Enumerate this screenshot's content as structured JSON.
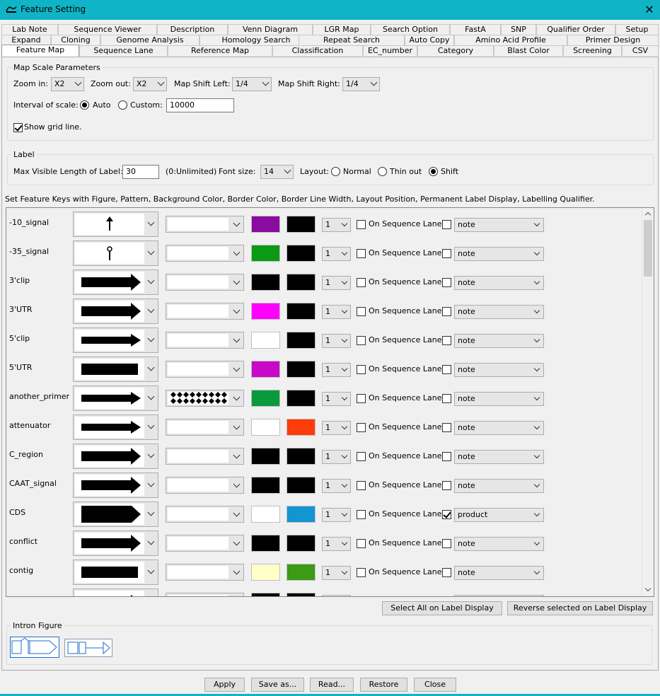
{
  "window": {
    "title": "Feature Setting",
    "close_glyph": "✕",
    "accent": "#0fb4c6"
  },
  "tabs": {
    "row1": [
      "Lab Note",
      "Sequence Viewer",
      "Description",
      "Venn Diagram",
      "LGR Map",
      "Search Option",
      "FastA",
      "SNP",
      "Qualifier Order",
      "Setup"
    ],
    "row2": [
      "Expand",
      "Cloning",
      "Genome Analysis",
      "Homology Search",
      "Repeat Search",
      "Auto Copy",
      "Amino Acid Profile",
      "Primer Design"
    ],
    "row3": [
      "Feature Map",
      "Sequence Lane",
      "Reference Map",
      "Classification",
      "EC_number",
      "Category",
      "Blast Color",
      "Screening",
      "CSV"
    ],
    "active": "Feature Map"
  },
  "map_scale": {
    "legend": "Map Scale Parameters",
    "zoom_in_label": "Zoom in:",
    "zoom_in_value": "X2",
    "zoom_out_label": "Zoom out:",
    "zoom_out_value": "X2",
    "shift_left_label": "Map Shift Left:",
    "shift_left_value": "1/4",
    "shift_right_label": "Map Shift Right:",
    "shift_right_value": "1/4",
    "interval_label": "Interval of scale:",
    "auto_label": "Auto",
    "custom_label": "Custom:",
    "custom_value": "10000",
    "interval_selected": "Auto",
    "grid_label": "Show grid line.",
    "grid_checked": true
  },
  "label_group": {
    "legend": "Label",
    "max_len_label": "Max Visible Length of Label:",
    "max_len_value": "30",
    "unlimited_note": "(0:Unlimited)",
    "font_size_label": "Font size:",
    "font_size_value": "14",
    "layout_label": "Layout:",
    "layout_options": [
      "Normal",
      "Thin out",
      "Shift"
    ],
    "layout_selected": "Shift"
  },
  "instructions": "Set Feature Keys with Figure, Pattern, Background Color, Border Color, Border Line Width, Layout Position, Permanent Label Display, Labelling Qualifier.",
  "seq_lane_label": "On Sequence Lane",
  "features": [
    {
      "name": "-10_signal",
      "figure": "up-arrow-icon",
      "pattern": "none",
      "bg": "#8b0a9f",
      "border": "#000000",
      "width": "1",
      "on_lane": false,
      "label_display": false,
      "qualifier": "note"
    },
    {
      "name": "-35_signal",
      "figure": "pin-icon",
      "pattern": "none",
      "bg": "#0a9a14",
      "border": "#000000",
      "width": "1",
      "on_lane": false,
      "label_display": false,
      "qualifier": "note"
    },
    {
      "name": "3'clip",
      "figure": "large-arrow",
      "pattern": "none",
      "bg": "#000000",
      "border": "#000000",
      "width": "1",
      "on_lane": false,
      "label_display": false,
      "qualifier": "note"
    },
    {
      "name": "3'UTR",
      "figure": "large-arrow",
      "pattern": "none",
      "bg": "#ff00ff",
      "border": "#000000",
      "width": "1",
      "on_lane": false,
      "label_display": false,
      "qualifier": "note"
    },
    {
      "name": "5'clip",
      "figure": "medium-arrow",
      "pattern": "none",
      "bg": "#ffffff",
      "border": "#000000",
      "width": "1",
      "on_lane": false,
      "label_display": false,
      "qualifier": "note"
    },
    {
      "name": "5'UTR",
      "figure": "bar",
      "pattern": "none",
      "bg": "#c80ac8",
      "border": "#000000",
      "width": "1",
      "on_lane": false,
      "label_display": false,
      "qualifier": "note"
    },
    {
      "name": "another_primer",
      "figure": "medium-arrow",
      "pattern": "diamonds",
      "bg": "#0a9a3c",
      "border": "#000000",
      "width": "1",
      "on_lane": false,
      "label_display": false,
      "qualifier": "note"
    },
    {
      "name": "attenuator",
      "figure": "medium-arrow",
      "pattern": "none",
      "bg": "#ffffff",
      "border": "#ff3c0a",
      "width": "1",
      "on_lane": false,
      "label_display": false,
      "qualifier": "note"
    },
    {
      "name": "C_region",
      "figure": "large-arrow",
      "pattern": "none",
      "bg": "#000000",
      "border": "#000000",
      "width": "1",
      "on_lane": false,
      "label_display": false,
      "qualifier": "note"
    },
    {
      "name": "CAAT_signal",
      "figure": "large-arrow",
      "pattern": "none",
      "bg": "#000000",
      "border": "#000000",
      "width": "1",
      "on_lane": false,
      "label_display": false,
      "qualifier": "note"
    },
    {
      "name": "CDS",
      "figure": "large-block-arrow",
      "pattern": "none",
      "bg": "#ffffff",
      "border": "#1296d2",
      "width": "1",
      "on_lane": false,
      "label_display": true,
      "qualifier": "product"
    },
    {
      "name": "conflict",
      "figure": "large-arrow",
      "pattern": "none",
      "bg": "#000000",
      "border": "#000000",
      "width": "1",
      "on_lane": false,
      "label_display": false,
      "qualifier": "note"
    },
    {
      "name": "contig",
      "figure": "bar",
      "pattern": "none",
      "bg": "#ffffc8",
      "border": "#3c9a14",
      "width": "1",
      "on_lane": false,
      "label_display": false,
      "qualifier": "note"
    }
  ],
  "buttons": {
    "select_all": "Select All on Label Display",
    "reverse": "Reverse selected on Label Display",
    "apply": "Apply",
    "save_as": "Save as...",
    "read": "Read...",
    "restore": "Restore",
    "close": "Close"
  },
  "intron": {
    "legend": "Intron Figure"
  }
}
